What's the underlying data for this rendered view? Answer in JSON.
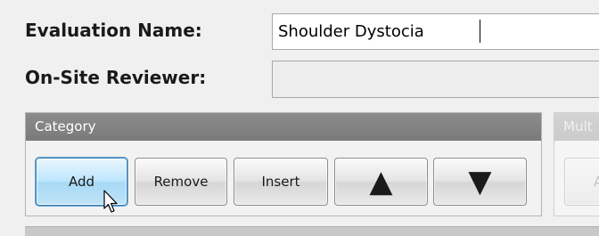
{
  "form": {
    "evaluation_name_label": "Evaluation Name:",
    "evaluation_name_value": "Shoulder Dystocia",
    "reviewer_label": "On-Site Reviewer:",
    "reviewer_value": ""
  },
  "category_panel": {
    "title": "Category",
    "buttons": {
      "add": "Add",
      "remove": "Remove",
      "insert": "Insert",
      "move_up": "▲",
      "move_down": "▼"
    }
  },
  "multi_panel": {
    "title": "Mult",
    "button_label": "A"
  },
  "icons": {
    "move_up": "up-triangle-icon",
    "move_down": "down-triangle-icon",
    "cursor": "mouse-pointer-icon"
  },
  "colors": {
    "panel_header": "#7f7f7f",
    "selected_button": "#bee6fd",
    "selected_border": "#3c7fb1"
  }
}
